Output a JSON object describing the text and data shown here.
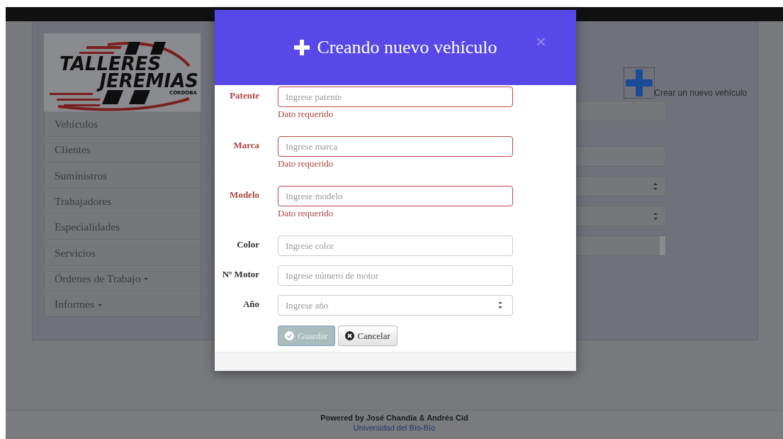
{
  "logo": {
    "lines": [
      "TALLERES",
      "JEREMIAS",
      "CORDOBA"
    ]
  },
  "sidebar": {
    "items": [
      {
        "label": "Vehículos",
        "dropdown": false
      },
      {
        "label": "Clientes",
        "dropdown": false
      },
      {
        "label": "Suministros",
        "dropdown": false
      },
      {
        "label": "Trabajadores",
        "dropdown": false
      },
      {
        "label": "Especialidades",
        "dropdown": false
      },
      {
        "label": "Servicios",
        "dropdown": false
      },
      {
        "label": "Órdenes de Trabajo",
        "dropdown": true
      },
      {
        "label": "Informes",
        "dropdown": true
      }
    ]
  },
  "create_link": {
    "label": "Crear un nuevo vehículo"
  },
  "background_fields": [
    {
      "kind": "text"
    },
    {
      "kind": "text"
    },
    {
      "kind": "number"
    },
    {
      "kind": "number"
    },
    {
      "kind": "select"
    }
  ],
  "modal": {
    "title": "Creando nuevo vehículo",
    "close": "×",
    "fields": [
      {
        "label": "Patente",
        "placeholder": "Ingrese patente",
        "kind": "text",
        "invalid": true,
        "error": "Dato requerido"
      },
      {
        "label": "Marca",
        "placeholder": "Ingrese marca",
        "kind": "text",
        "invalid": true,
        "error": "Dato requerido"
      },
      {
        "label": "Modelo",
        "placeholder": "Ingrese modelo",
        "kind": "text",
        "invalid": true,
        "error": "Dato requerido"
      },
      {
        "label": "Color",
        "placeholder": "Ingrese color",
        "kind": "text",
        "invalid": false
      },
      {
        "label": "Nº Motor",
        "placeholder": "Ingrese número de motor",
        "kind": "text",
        "invalid": false
      },
      {
        "label": "Año",
        "placeholder": "Ingrese año",
        "kind": "number",
        "invalid": false
      }
    ],
    "buttons": [
      {
        "label": "Guardar",
        "kind": "save",
        "disabled": true
      },
      {
        "label": "Cancelar",
        "kind": "cancel",
        "disabled": false
      }
    ]
  },
  "footer": {
    "credit": "Powered by José Chandía & Andrés Cid",
    "link": "Universidad del Bío-Bío"
  }
}
